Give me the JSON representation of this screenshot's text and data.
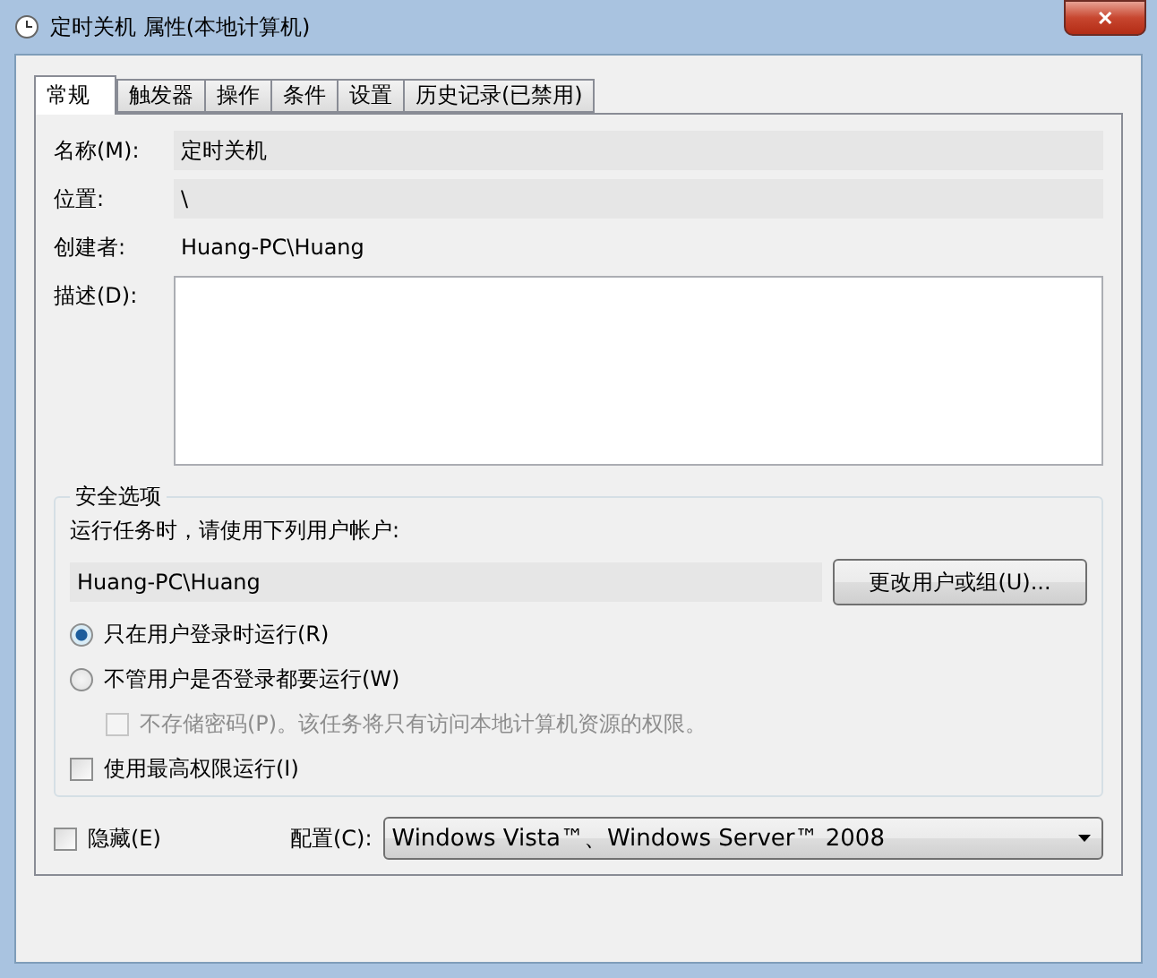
{
  "window": {
    "title": "定时关机 属性(本地计算机)",
    "close": "✕"
  },
  "tabs": [
    {
      "label": "常规",
      "selected": true
    },
    {
      "label": "触发器",
      "selected": false
    },
    {
      "label": "操作",
      "selected": false
    },
    {
      "label": "条件",
      "selected": false
    },
    {
      "label": "设置",
      "selected": false
    },
    {
      "label": "历史记录(已禁用)",
      "selected": false
    }
  ],
  "fields": [
    {
      "kind": "field",
      "label": "名称(M):",
      "value": "定时关机"
    },
    {
      "kind": "field",
      "label": "位置:",
      "value": "\\"
    },
    {
      "kind": "text",
      "label": "创建者:",
      "value": "Huang-PC\\Huang"
    },
    {
      "kind": "textarea",
      "label": "描述(D):"
    }
  ],
  "security": {
    "title": "安全选项",
    "prompt": "运行任务时，请使用下列用户帐户:",
    "account": "Huang-PC\\Huang",
    "change_button": "更改用户或组(U)...",
    "options": [
      {
        "kind": "radio",
        "label": "只在用户登录时运行(R)",
        "selected": true
      },
      {
        "kind": "radio",
        "label": "不管用户是否登录都要运行(W)",
        "selected": false,
        "children": [
          {
            "kind": "checkbox",
            "label": "不存储密码(P)。该任务将只有访问本地计算机资源的权限。",
            "checked": false,
            "disabled": true
          }
        ]
      },
      {
        "kind": "checkbox",
        "label": "使用最高权限运行(I)",
        "checked": false,
        "disabled": false
      }
    ]
  },
  "hidden": {
    "label": "隐藏(E)",
    "checked": false
  },
  "config": {
    "label": "配置(C):",
    "value": "Windows Vista™、Windows Server™ 2008"
  }
}
